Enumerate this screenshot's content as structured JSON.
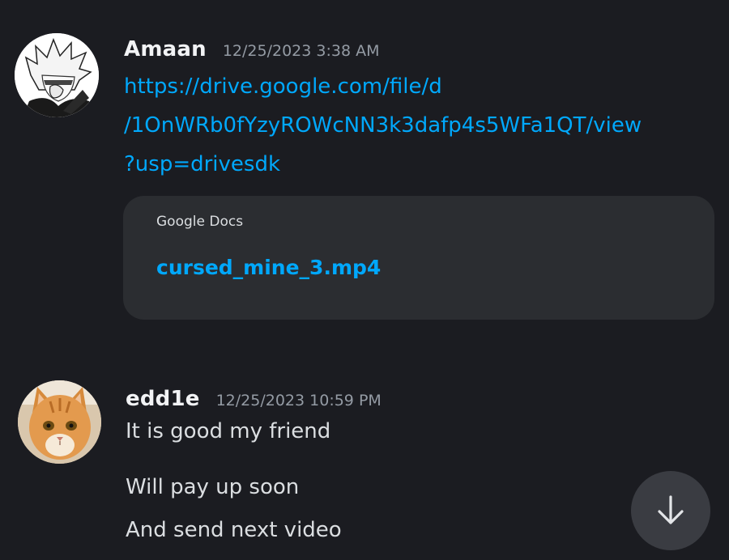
{
  "messages": [
    {
      "username": "Amaan",
      "timestamp": "12/25/2023 3:38 AM",
      "avatar_icon": "anime-character-avatar-icon",
      "link_lines": [
        "https://drive.google.com/file/d",
        "/1OnWRb0fYzyROWcNN3k3dafp4s5WFa1QT/view",
        "?usp=drivesdk"
      ],
      "embed": {
        "provider": "Google Docs",
        "title": "cursed_mine_3.mp4"
      }
    },
    {
      "username": "edd1e",
      "timestamp": "12/25/2023 10:59 PM",
      "avatar_icon": "orange-cat-avatar-icon",
      "lines": [
        "It is good my friend",
        "Will pay up soon",
        "And send next video"
      ]
    }
  ],
  "scroll_button": {
    "icon": "arrow-down-icon"
  },
  "colors": {
    "background": "#1b1c21",
    "link": "#00a8fc",
    "username": "#f2f3f5",
    "timestamp": "#949ba4",
    "embed_background": "#2b2d31",
    "scroll_button": "#3a3c42"
  }
}
